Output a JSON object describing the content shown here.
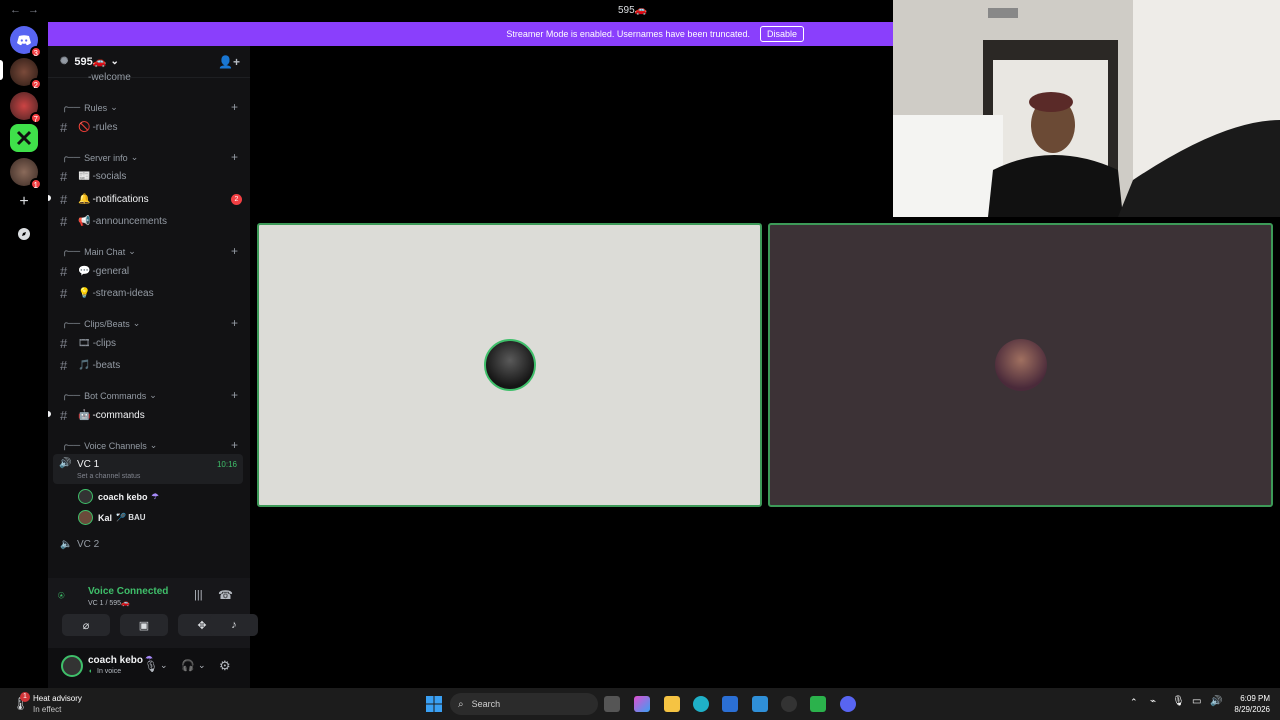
{
  "window": {
    "title": "595🚗",
    "back": "←",
    "forward": "→"
  },
  "banner": {
    "text": "Streamer Mode is enabled. Usernames have been truncated.",
    "disable_label": "Disable"
  },
  "rail": {
    "home_badge": "3",
    "server_badges": [
      "2",
      "7",
      "1"
    ]
  },
  "server": {
    "name": "595🚗",
    "chevron": "⌄"
  },
  "sidebar": {
    "partial_channel": "-welcome",
    "categories": [
      {
        "label": "Rules"
      },
      {
        "label": "Server info"
      },
      {
        "label": "Main Chat"
      },
      {
        "label": "Clips/Beats"
      },
      {
        "label": "Bot Commands"
      },
      {
        "label": "Voice Channels"
      }
    ],
    "channels": [
      {
        "label": "-rules",
        "emoji": "🚫"
      },
      {
        "label": "-socials",
        "emoji": "📰"
      },
      {
        "label": "-notifications",
        "emoji": "🔔",
        "badge": "2"
      },
      {
        "label": "-announcements",
        "emoji": "📢"
      },
      {
        "label": "-general",
        "emoji": "💬"
      },
      {
        "label": "-stream-ideas",
        "emoji": "💡"
      },
      {
        "label": "-clips",
        "emoji": "🎞"
      },
      {
        "label": "-beats",
        "emoji": "🎵"
      },
      {
        "label": "-commands",
        "emoji": "🤖"
      }
    ],
    "voice": {
      "vc1": {
        "label": "VC 1",
        "timer": "10:16",
        "status": "Set a channel status"
      },
      "members": [
        {
          "name": "coach kebo",
          "tag": "☂"
        },
        {
          "name": "Kal",
          "tag": "🏸 BAU"
        }
      ],
      "vc2": {
        "label": "VC 2"
      }
    }
  },
  "voice_panel": {
    "status": "Voice Connected",
    "channel": "VC 1 / 595🚗",
    "user": "coach kebo",
    "user_tag": "☂",
    "user_status": "In voice"
  },
  "taskbar": {
    "weather_title": "Heat advisory",
    "weather_sub": "In effect",
    "weather_badge": "1",
    "search_placeholder": "Search",
    "time": "6:09 PM",
    "date": "8/29/2026"
  },
  "colors": {
    "accent": "#8a3ffc",
    "voice_green": "#3d9a58",
    "badge_red": "#f23f43"
  }
}
